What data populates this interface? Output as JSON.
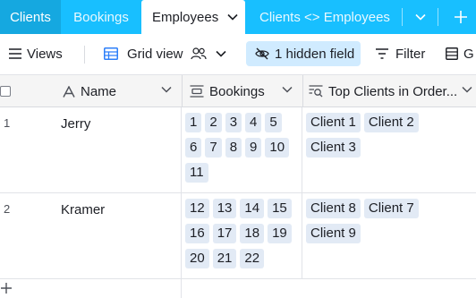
{
  "tabs": {
    "clients": "Clients",
    "bookings": "Bookings",
    "employees": "Employees",
    "clients_employees": "Clients <> Employees"
  },
  "toolbar": {
    "views_label": "Views",
    "view_name": "Grid view",
    "hidden_label": "1 hidden field",
    "filter_label": "Filter",
    "group_label": "G"
  },
  "columns": {
    "name": "Name",
    "bookings": "Bookings",
    "top_clients": "Top Clients in Order..."
  },
  "rows": [
    {
      "num": "1",
      "name": "Jerry",
      "bookings": [
        "1",
        "2",
        "3",
        "4",
        "5",
        "6",
        "7",
        "8",
        "9",
        "10",
        "11"
      ],
      "top_clients": [
        "Client 1",
        "Client 2",
        "Client 3"
      ]
    },
    {
      "num": "2",
      "name": "Kramer",
      "bookings": [
        "12",
        "13",
        "14",
        "15",
        "16",
        "17",
        "18",
        "19",
        "20",
        "21",
        "22"
      ],
      "top_clients": [
        "Client 8",
        "Client 7",
        "Client 9"
      ]
    }
  ],
  "colors": {
    "tabbar": "#18bfff",
    "active_tab": "#ffffff",
    "hidden_field_bg": "#d0ebff",
    "chip_bg": "#e2eaf5"
  }
}
